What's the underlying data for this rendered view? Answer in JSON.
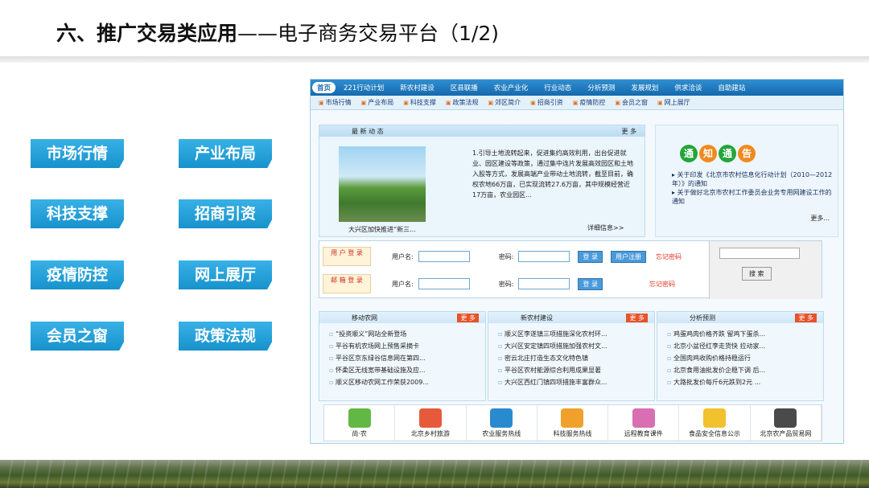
{
  "slide": {
    "title_bold": "六、推广交易类应用",
    "title_rest": "——电子商务交易平台（1/2)"
  },
  "pills": [
    "市场行情",
    "产业布局",
    "科技支撑",
    "招商引资",
    "疫情防控",
    "网上展厅",
    "会员之窗",
    "政策法规"
  ],
  "site": {
    "topnav": [
      "首页",
      "221行动计划",
      "新农村建设",
      "区县联播",
      "农业产业化",
      "行业动态",
      "分析预测",
      "发展规划",
      "供求洽谈",
      "自助建站"
    ],
    "subnav": [
      "市场行情",
      "产业布局",
      "科技支撑",
      "政策法规",
      "郊区简介",
      "招商引资",
      "疫情防控",
      "会员之窗",
      "网上展厅"
    ],
    "news": {
      "heading": "最 新 动 态",
      "more": "更 多",
      "text": "1.引导土地流转起来，促进集约高效利用，出台促进就业、园区建设等政策，通过集中连片发展高效园区和土地入股等方式，发展高端产业带动土地流转，截至目前，确权农地66万亩，已实现流转27.6万亩，其中规模经营近17万亩，农业园区...",
      "caption": "大兴区加快推进“新三...",
      "detail": "详细信息>>"
    },
    "notice": {
      "badge": [
        "通",
        "知",
        "通",
        "告"
      ],
      "text1": "▸ 关于印发《北京市农村信息化行动计划（2010—2012年）》的通知",
      "text2": "▸ 关于做好北京市农村工作委员会业务专用网建设工作的通知",
      "more": "更多..."
    },
    "login": {
      "user_tag": "用 户 登 录",
      "mail_tag": "邮 箱 登 录",
      "username_label": "用户名:",
      "password_label": "密码:",
      "login_btn": "登 录",
      "register_btn": "用户注册",
      "forgot": "忘记密码",
      "search_btn": "搜 索"
    },
    "columns": [
      {
        "title": "移动农网",
        "more": "更 多",
        "items": [
          "“投资顺义”网站全新登场",
          "平谷有机农场网上预售采摘卡",
          "平谷区京东绿谷信息网在第四...",
          "怀柔区无线宽带基础设施及应...",
          "顺义区移动农网工作荣获2009..."
        ]
      },
      {
        "title": "新农村建设",
        "more": "更 多",
        "items": [
          "顺义区李遂镇三项措施深化农村环...",
          "大兴区安定镇四项措施加强农村文...",
          "密云北庄打造生态文化特色镇",
          "平谷区农村能源综合利用成果显著",
          "大兴区西红门镇四项措施丰富群众..."
        ]
      },
      {
        "title": "分析预测",
        "more": "更 多",
        "items": [
          "鸡蛋鸡肉价格齐跌 留鸡下蛋杀...",
          "北京小盆径红李走货快 拉动家...",
          "全国肉鸡收购价格持稳运行",
          "北京食用油批发价企稳下调 后...",
          "大路批发价每斤6元跌到2元 ..."
        ]
      }
    ],
    "links": [
      "尚·农",
      "北京乡村旅游",
      "农业服务热线",
      "科技服务热线",
      "远程教育课件",
      "食品安全信息公示",
      "北京农产品贸易网"
    ],
    "colors": {
      "nav": "#1a75bb",
      "pill": "#1e9ad6",
      "accent": "#e8522a"
    }
  }
}
